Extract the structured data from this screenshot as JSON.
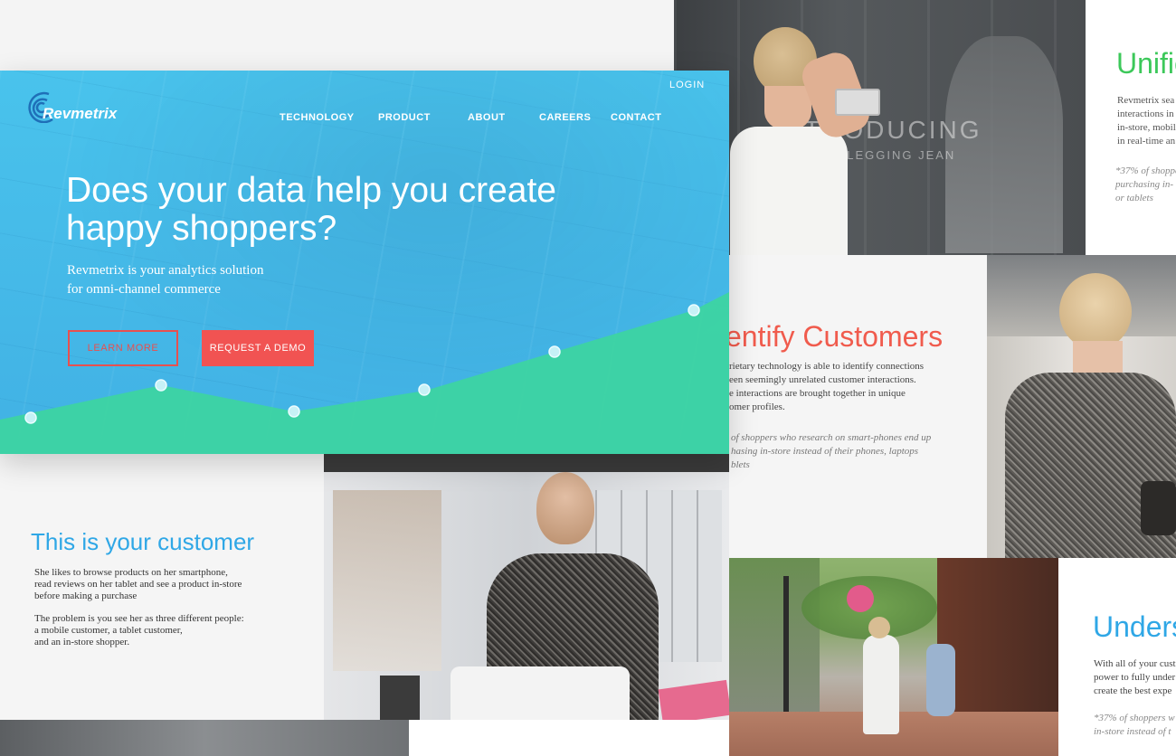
{
  "brand": {
    "name": "Revmetrix",
    "accent": "#f15352",
    "blue": "#2fa7e6",
    "green": "#3cd4a2"
  },
  "nav": {
    "login": "LOGIN",
    "items": [
      "TECHNOLOGY",
      "PRODUCT",
      "ABOUT",
      "CAREERS",
      "CONTACT"
    ]
  },
  "hero": {
    "headline_line1": "Does your data help you create",
    "headline_line2": "happy shoppers?",
    "subhead_line1": "Revmetrix is your analytics solution",
    "subhead_line2": "for omni-channel commerce",
    "learn_more": "LEARN MORE",
    "request_demo": "REQUEST A DEMO"
  },
  "customer": {
    "title": "This is your customer",
    "p1_l1": "She likes to browse products on her smartphone,",
    "p1_l2": "read reviews on her tablet and see a product in-store",
    "p1_l3": "before making a purchase",
    "p2_l1": "The problem is you see her as three different people:",
    "p2_l2": "a mobile customer, a tablet customer,",
    "p2_l3": "and an in-store shopper."
  },
  "identify": {
    "title": "entify Customers",
    "l1": "rietary technology is able to identify connections",
    "l2": "een seemingly unrelated customer interactions.",
    "l3": "e interactions are brought together in unique",
    "l4": "omer profiles.",
    "n1": "of shoppers who research on smart-phones end up",
    "n2": "hasing in-store instead of their phones, laptops",
    "n3": "blets"
  },
  "unified": {
    "title": "Unifie",
    "l1": "Revmetrix sea",
    "l2": "interactions in",
    "l3": "in-store, mobil",
    "l4": "in real-time an",
    "n1": "*37% of shoppe",
    "n2": "purchasing in-",
    "n3": "or tablets"
  },
  "understand": {
    "title": "Unders",
    "l1": "With all of your cust",
    "l2": "power to fully under",
    "l3": "create the best expe",
    "n1": "*37% of shoppers w",
    "n2": "in-store instead of t"
  },
  "photo": {
    "store_sign_line1": "INTRODUCING",
    "store_sign_line2": "BROOKE LEGGING JEAN"
  }
}
